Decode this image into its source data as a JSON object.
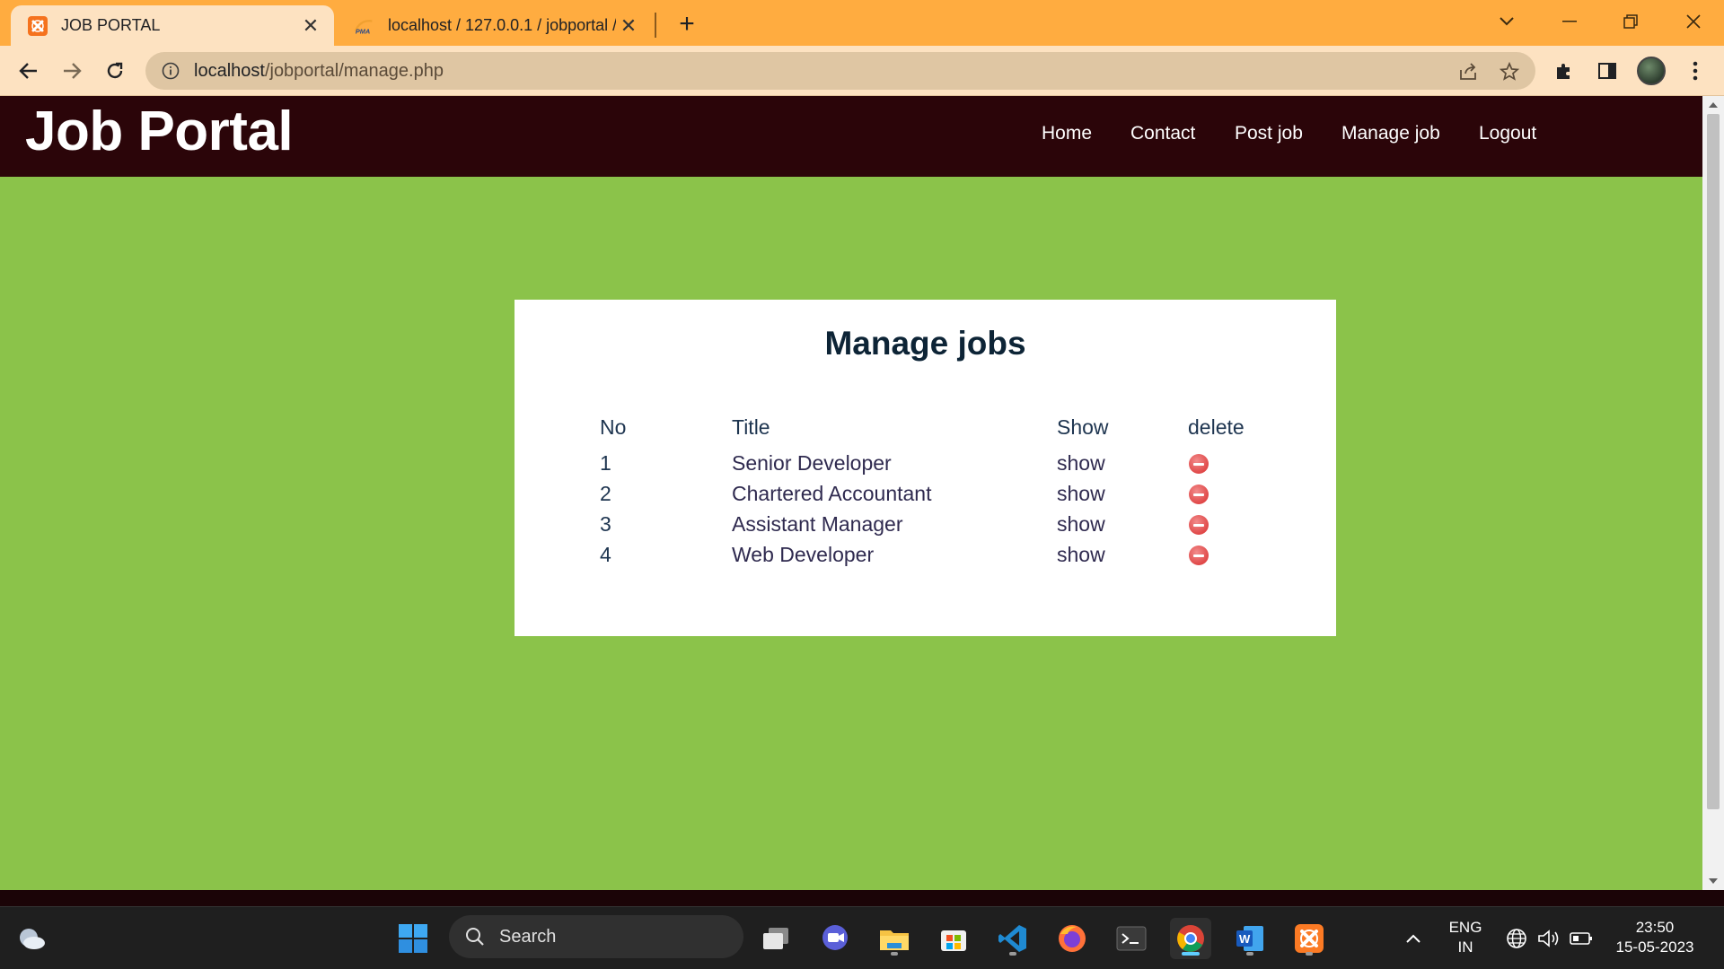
{
  "browser": {
    "tabs": [
      {
        "title": "JOB PORTAL",
        "active": true
      },
      {
        "title": "localhost / 127.0.0.1 / jobportal /",
        "active": false
      }
    ],
    "url_host": "localhost",
    "url_path": "/jobportal/manage.php"
  },
  "site": {
    "brand": "Job Portal",
    "nav": [
      "Home",
      "Contact",
      "Post job",
      "Manage job",
      "Logout"
    ]
  },
  "manage": {
    "heading": "Manage jobs",
    "columns": [
      "No",
      "Title",
      "Show",
      "delete"
    ],
    "rows": [
      {
        "no": "1",
        "title": "Senior Developer",
        "show": "show"
      },
      {
        "no": "2",
        "title": "Chartered Accountant",
        "show": "show"
      },
      {
        "no": "3",
        "title": "Assistant Manager",
        "show": "show"
      },
      {
        "no": "4",
        "title": "Web Developer",
        "show": "show"
      }
    ]
  },
  "taskbar": {
    "search_label": "Search",
    "language": "ENG",
    "region": "IN",
    "time": "23:50",
    "date": "15-05-2023"
  },
  "colors": {
    "page_bg": "#8bc34a",
    "header_bg": "#2b0509",
    "tab_strip": "#ffac40",
    "delete_icon": "#e04848"
  }
}
